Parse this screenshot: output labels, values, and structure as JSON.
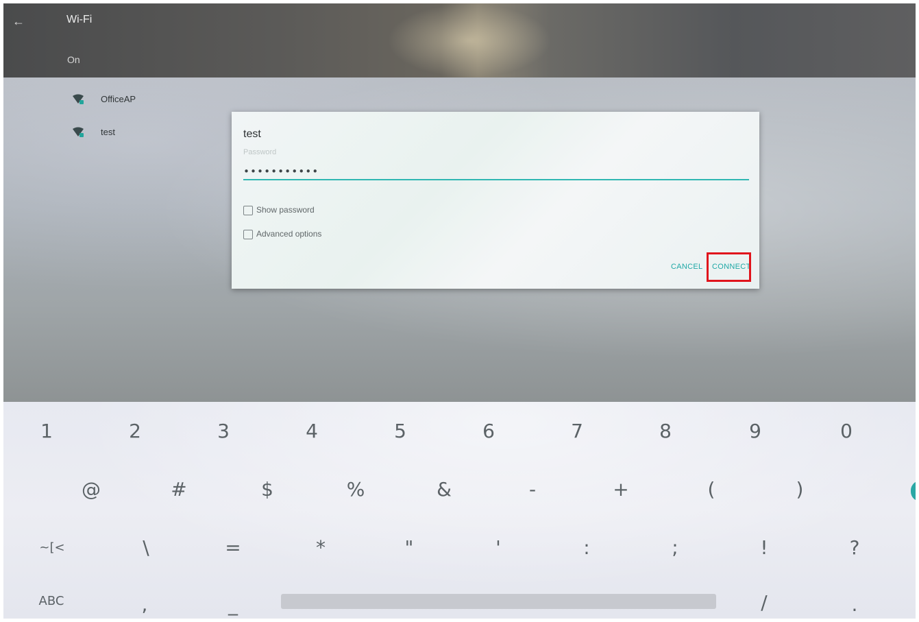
{
  "appbar": {
    "back_icon": "arrow-left-icon",
    "title": "Wi-Fi",
    "status": "On"
  },
  "networks": [
    {
      "name": "OfficeAP",
      "icon": "wifi-lock-icon"
    },
    {
      "name": "test",
      "icon": "wifi-lock-icon"
    }
  ],
  "dialog": {
    "title": "test",
    "password_label": "Password",
    "password_value": "•••••••••••",
    "show_password_label": "Show password",
    "advanced_options_label": "Advanced options",
    "cancel_label": "CANCEL",
    "connect_label": "CONNECT",
    "highlight_color": "#e0141c",
    "accent_color": "#1fa8a6"
  },
  "keyboard": {
    "row1": [
      "1",
      "2",
      "3",
      "4",
      "5",
      "6",
      "7",
      "8",
      "9",
      "0"
    ],
    "row2": [
      "@",
      "#",
      "$",
      "%",
      "&",
      "-",
      "+",
      "(",
      ")"
    ],
    "row3": [
      "~[<",
      "\\",
      "=",
      "*",
      "\"",
      "'",
      ":",
      ";",
      "!",
      "?"
    ],
    "row4": [
      "ABC",
      ",",
      "_",
      "/",
      "."
    ]
  }
}
